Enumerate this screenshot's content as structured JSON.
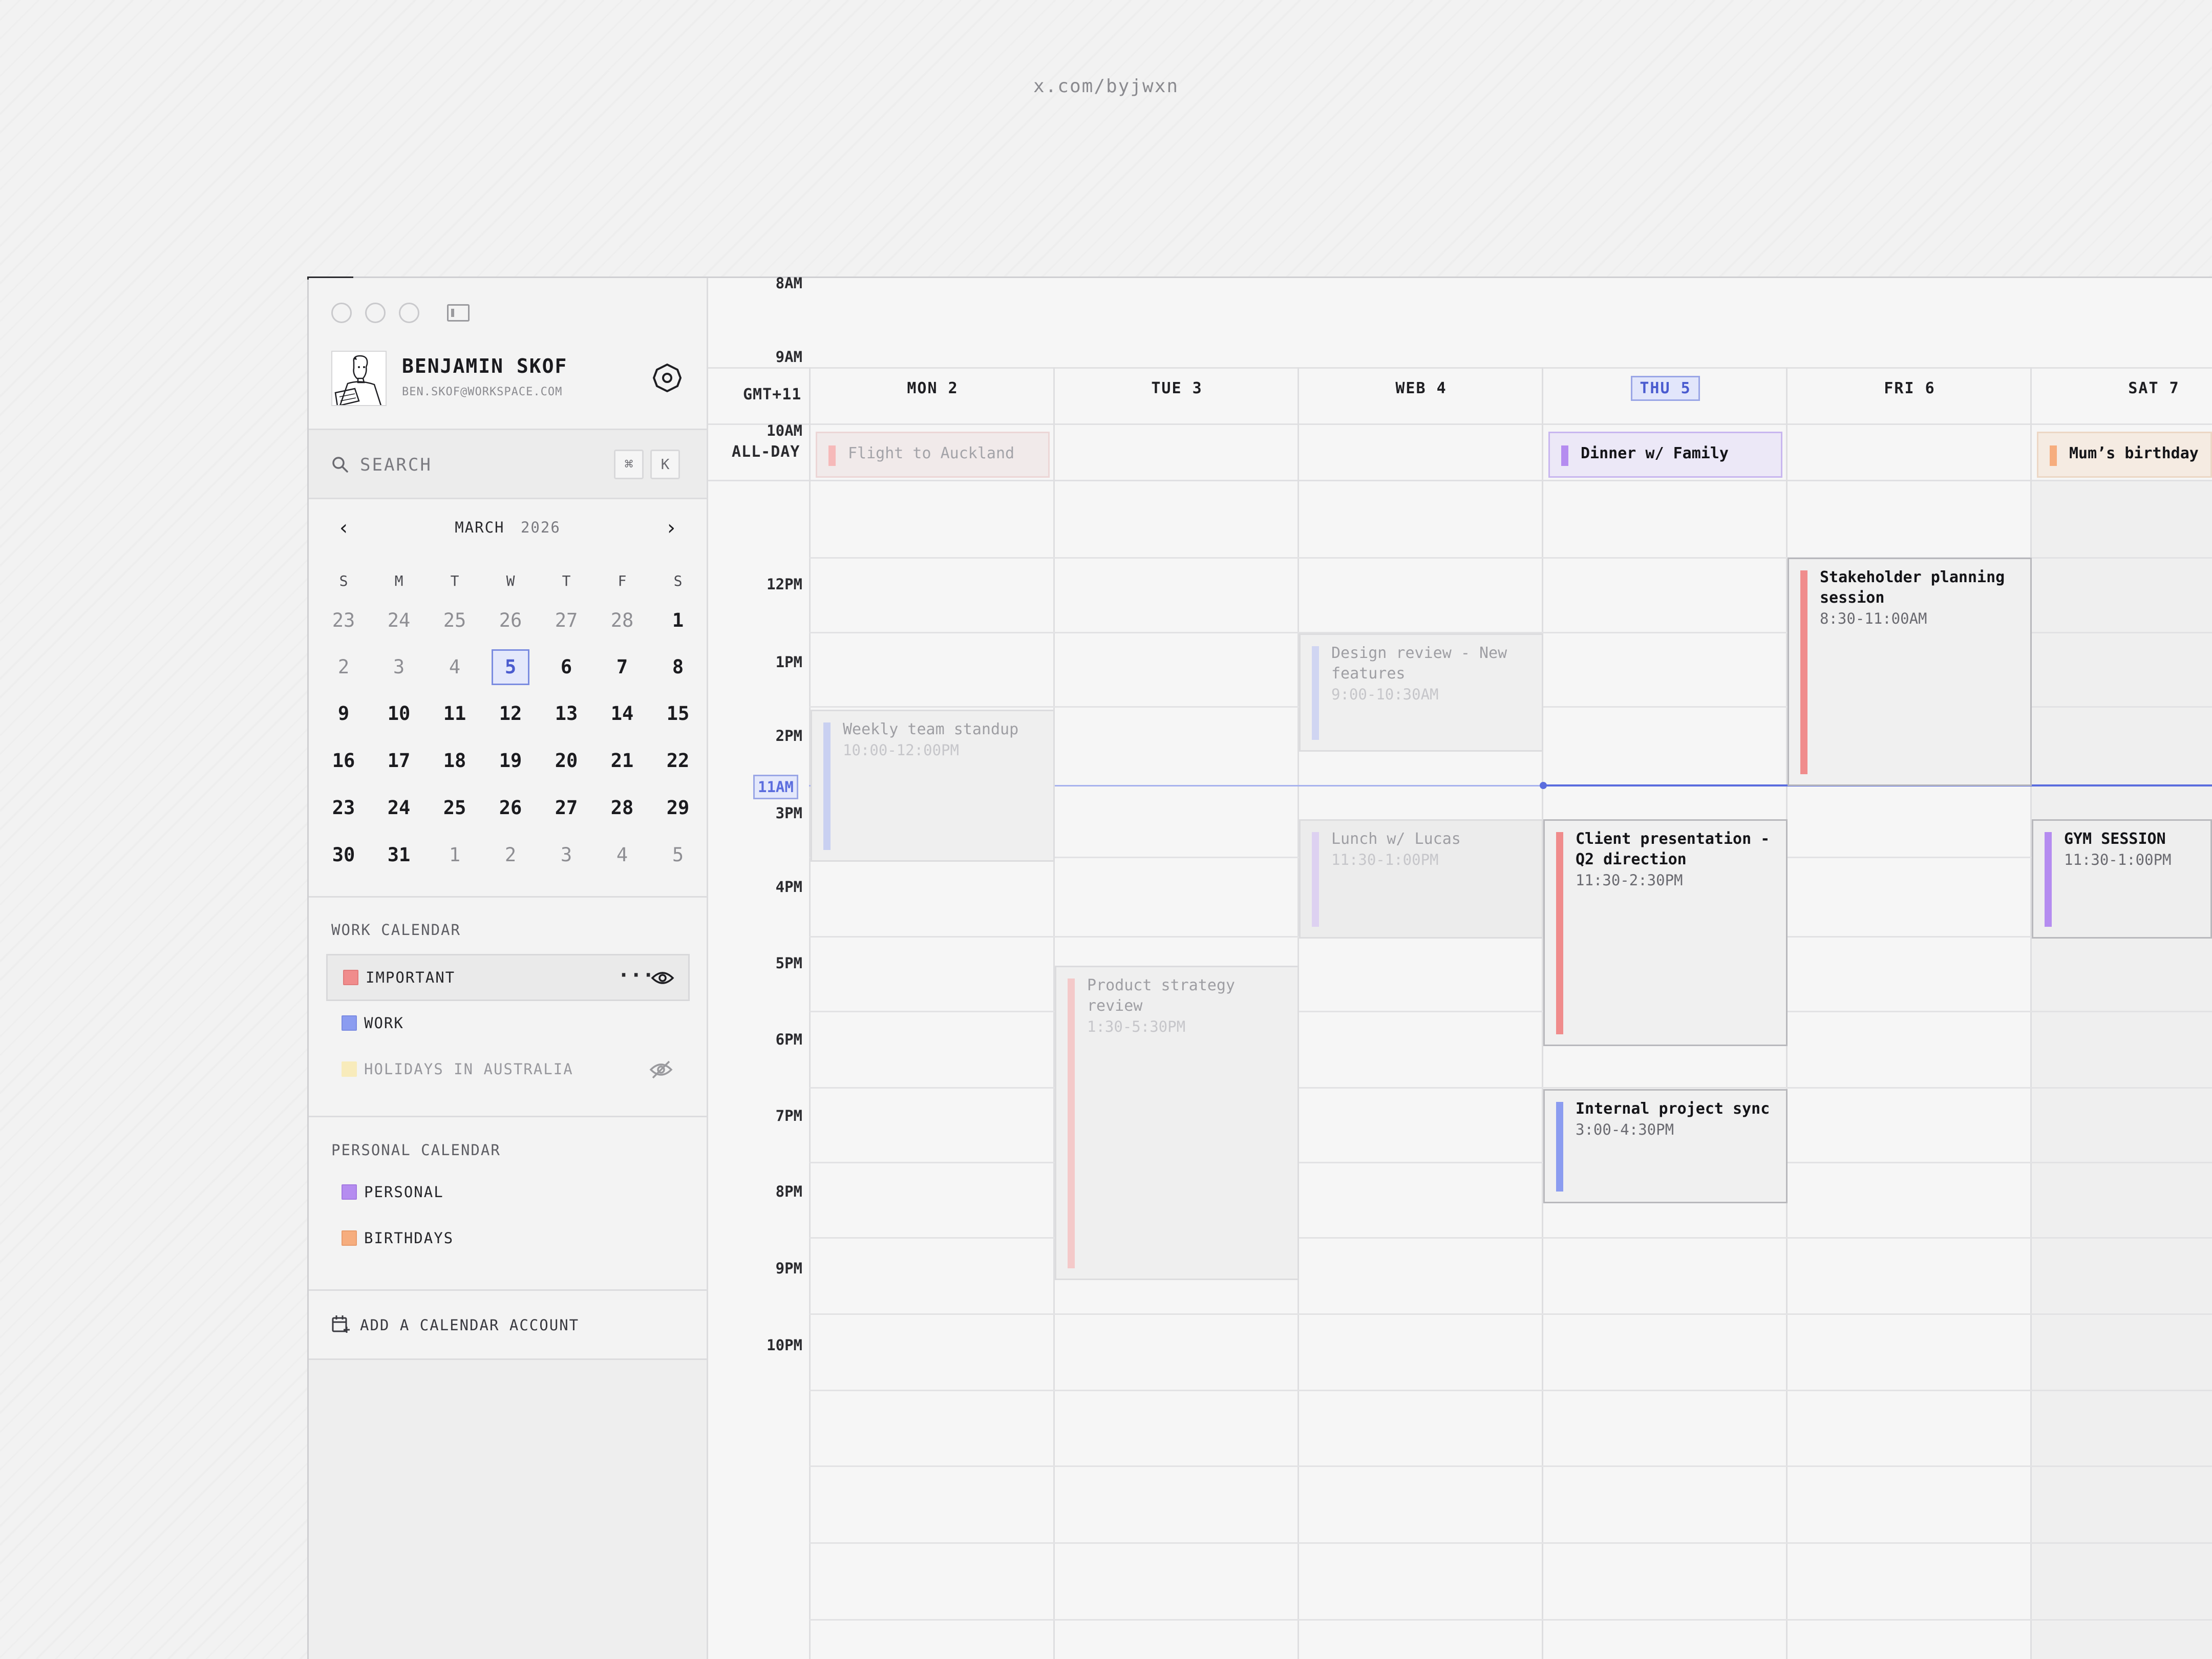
{
  "watermark": "x.com/byjwxn",
  "user": {
    "name": "BENJAMIN SKOF",
    "email": "BEN.SKOF@WORKSPACE.COM"
  },
  "search": {
    "label": "SEARCH",
    "kbd_cmd": "⌘",
    "kbd_key": "K"
  },
  "mini_calendar": {
    "month": "MARCH",
    "year": "2026",
    "prev": "‹",
    "next": "›",
    "dow": [
      "S",
      "M",
      "T",
      "W",
      "T",
      "F",
      "S"
    ],
    "weeks": [
      [
        "23",
        "24",
        "25",
        "26",
        "27",
        "28",
        "1"
      ],
      [
        "2",
        "3",
        "4",
        "5",
        "6",
        "7",
        "8"
      ],
      [
        "9",
        "10",
        "11",
        "12",
        "13",
        "14",
        "15"
      ],
      [
        "16",
        "17",
        "18",
        "19",
        "20",
        "21",
        "22"
      ],
      [
        "23",
        "24",
        "25",
        "26",
        "27",
        "28",
        "29"
      ],
      [
        "30",
        "31",
        "1",
        "2",
        "3",
        "4",
        "5"
      ]
    ],
    "selected": "5"
  },
  "work_calendar": {
    "label": "WORK CALENDAR",
    "items": [
      {
        "label": "IMPORTANT",
        "color": "#f08c8c"
      },
      {
        "label": "WORK",
        "color": "#8b9cf0"
      },
      {
        "label": "HOLIDAYS IN AUSTRALIA",
        "color": "#f8e9b4"
      }
    ],
    "more": "···"
  },
  "personal_calendar": {
    "label": "PERSONAL CALENDAR",
    "items": [
      {
        "label": "PERSONAL",
        "color": "#b58cf0"
      },
      {
        "label": "BIRTHDAYS",
        "color": "#f6ad7e"
      }
    ]
  },
  "add_account": "ADD A CALENDAR ACCOUNT",
  "week": {
    "timezone": "GMT+11",
    "all_day_label": "ALL-DAY",
    "days": [
      "MON 2",
      "TUE 3",
      "WEB 4",
      "THU 5",
      "FRI 6",
      "SAT 7"
    ],
    "today_index": 3,
    "hours": [
      "8AM",
      "9AM",
      "10AM",
      "12PM",
      "1PM",
      "2PM",
      "3PM",
      "4PM",
      "5PM",
      "6PM",
      "7PM",
      "8PM",
      "9PM",
      "10PM"
    ],
    "now_label": "11AM"
  },
  "all_day_events": [
    {
      "title": "Flight to Auckland",
      "day": "MON 2",
      "color": "#f6b9b9"
    },
    {
      "title": "Dinner w/ Family",
      "day": "THU 5",
      "color": "#b58cf0"
    },
    {
      "title": "Mum’s birthday",
      "day": "SAT 7",
      "color": "#f6ad7e"
    }
  ],
  "events": [
    {
      "title": "Weekly team standup",
      "time": "10:00-12:00PM",
      "day": "MON 2",
      "color": "#b9c3f2"
    },
    {
      "title": "Product strategy review",
      "time": "1:30-5:30PM",
      "day": "TUE 3",
      "color": "#f6b9b9"
    },
    {
      "title": "Design review - New features",
      "time": "9:00-10:30AM",
      "day": "WEB 4",
      "color": "#c3cbf4"
    },
    {
      "title": "Lunch w/ Lucas",
      "time": "11:30-1:00PM",
      "day": "WEB 4",
      "color": "#d7c6f4"
    },
    {
      "title": "Client presentation - Q2 direction",
      "time": "11:30-2:30PM",
      "day": "THU 5",
      "color": "#f08c8c"
    },
    {
      "title": "Internal project sync",
      "time": "3:00-4:30PM",
      "day": "THU 5",
      "color": "#8b9cf0"
    },
    {
      "title": "Stakeholder planning session",
      "time": "8:30-11:00AM",
      "day": "FRI 6",
      "color": "#f08c8c"
    },
    {
      "title": "GYM SESSION",
      "time": "11:30-1:00PM",
      "day": "SAT 7",
      "color": "#b58cf0"
    }
  ]
}
